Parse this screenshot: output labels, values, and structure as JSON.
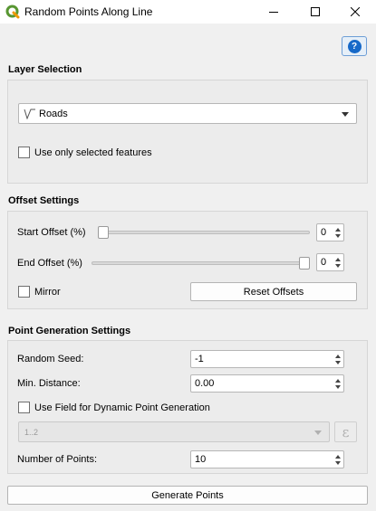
{
  "window": {
    "title": "Random Points Along Line",
    "icon": "qgis-logo-icon",
    "controls": [
      "minimize-icon",
      "maximize-icon",
      "close-icon"
    ]
  },
  "help": {
    "label": "?"
  },
  "layer_selection": {
    "title": "Layer Selection",
    "layer": {
      "value": "Roads",
      "icon": "line-layer-icon"
    },
    "selected_only": {
      "label": "Use only selected features",
      "checked": false
    }
  },
  "offset_settings": {
    "title": "Offset Settings",
    "start": {
      "label": "Start Offset (%)",
      "value": "0",
      "slider_fraction": 0.0
    },
    "end": {
      "label": "End Offset (%)",
      "value": "0",
      "slider_fraction": 1.0
    },
    "mirror": {
      "label": "Mirror",
      "checked": false
    },
    "reset_label": "Reset Offsets"
  },
  "point_generation": {
    "title": "Point Generation Settings",
    "random_seed": {
      "label": "Random Seed:",
      "value": "-1"
    },
    "min_distance": {
      "label": "Min. Distance:",
      "value": "0.00"
    },
    "dynamic": {
      "label": "Use Field for Dynamic Point Generation",
      "checked": false
    },
    "field": {
      "value": "1..2",
      "disabled": true
    },
    "expression_label": "ε",
    "num_points": {
      "label": "Number of Points:",
      "value": "10"
    }
  },
  "generate_label": "Generate Points",
  "colors": {
    "help_blue": "#1769c8",
    "qgis_green": "#589632",
    "qgis_yellow": "#ee9900"
  }
}
